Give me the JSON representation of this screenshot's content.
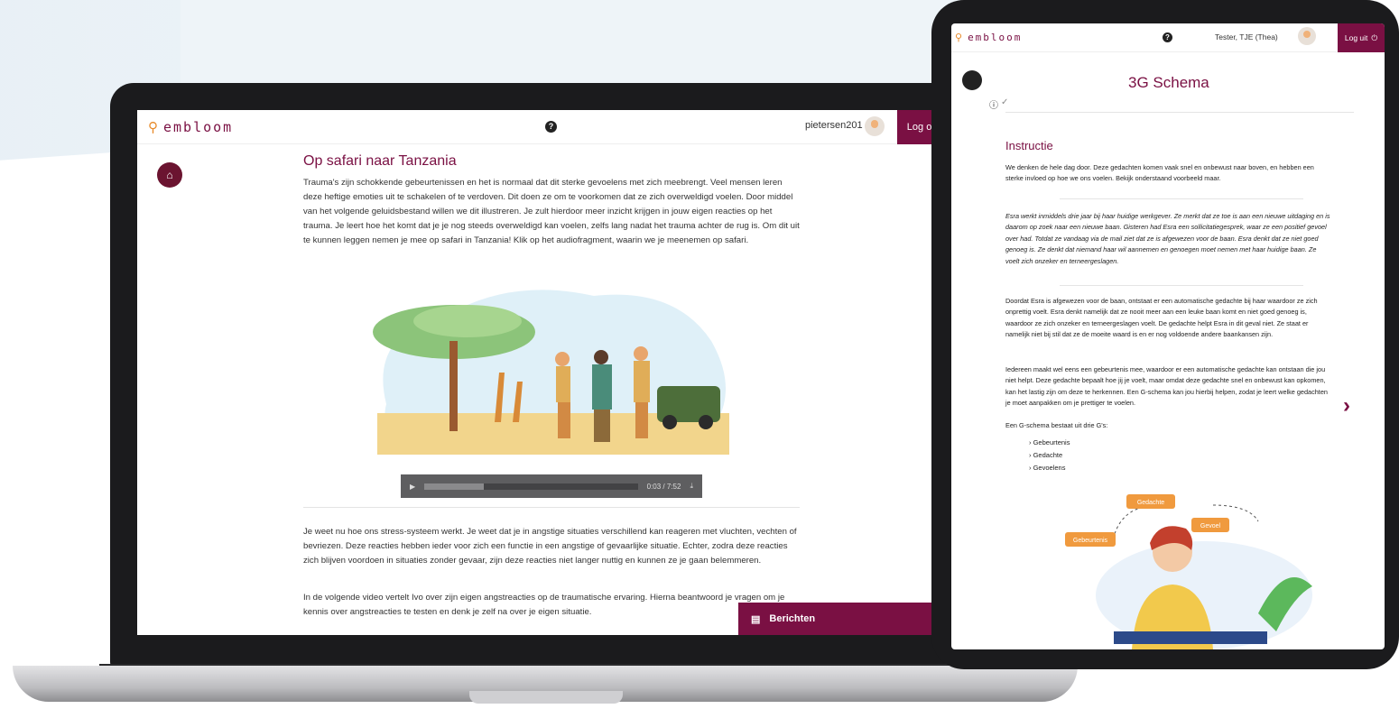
{
  "laptop": {
    "logo": "embloom",
    "username": "pietersen201",
    "logout_label": "Log out",
    "title": "Op safari naar Tanzania",
    "paragraphs": [
      "Trauma's zijn schokkende gebeurtenissen en het is normaal dat dit sterke gevoelens met zich meebrengt. Veel mensen leren deze heftige emoties uit te schakelen of te verdoven. Dit doen ze om te voorkomen dat ze zich overweldigd voelen. Door middel van het volgende geluidsbestand willen we dit illustreren. Je zult hierdoor meer inzicht krijgen in jouw eigen reacties op het trauma. Je leert hoe het komt dat je je nog steeds overweldigd kan voelen, zelfs lang nadat het trauma achter de rug is. Om dit uit te kunnen leggen nemen je mee op safari in Tanzania! Klik op het audiofragment, waarin we je meenemen op safari.",
      "Je weet nu hoe ons stress-systeem werkt. Je weet dat je in angstige situaties verschillend kan reageren met vluchten, vechten of bevriezen. Deze reacties hebben ieder voor zich een functie in een angstige of gevaarlijke situatie. Echter, zodra deze reacties zich blijven voordoen in situaties zonder gevaar, zijn deze reacties niet langer nuttig en kunnen ze je gaan belemmeren.",
      "In de volgende video vertelt Ivo over zijn eigen angstreacties op de traumatische ervaring. Hierna beantwoord je vragen om je kennis over angstreacties te testen en denk je zelf na over je eigen situatie."
    ],
    "audio": {
      "current": "0:03",
      "duration": "7:52",
      "progress": 0.28
    },
    "messages_label": "Berichten"
  },
  "tablet": {
    "logo": "embloom",
    "username": "Tester, TJE (Thea)",
    "logout_label": "Log uit",
    "title": "3G Schema",
    "section_heading": "Instructie",
    "intro": "We denken de hele dag door. Deze gedachten komen vaak snel en onbewust naar boven, en hebben een sterke invloed op hoe we ons voelen. Bekijk onderstaand voorbeeld maar.",
    "example": "Esra werkt inmiddels drie jaar bij haar huidige werkgever. Ze merkt dat ze toe is aan een nieuwe uitdaging en is daarom op zoek naar een nieuwe baan. Gisteren had Esra een sollicitatiegesprek, waar ze een positief gevoel over had. Totdat ze vandaag via de mail ziet dat ze is afgewezen voor de baan. Esra denkt dat ze niet goed genoeg is. Ze denkt dat niemand haar wil aannemen en genoegen moet nemen met haar huidige baan. Ze voelt zich onzeker en terneergeslagen.",
    "para1": "Doordat Esra is afgewezen voor de baan, ontstaat er een automatische gedachte bij haar waardoor ze zich onprettig voelt. Esra denkt namelijk dat ze nooit meer aan een leuke baan komt en niet goed genoeg is, waardoor ze zich onzeker en terneergeslagen voelt. De gedachte helpt Esra in dit geval niet. Ze staat er namelijk niet bij stil dat ze de moeite waard is en er nog voldoende andere baankansen zijn.",
    "para2": "Iedereen maakt wel eens een gebeurtenis mee, waardoor er een automatische gedachte kan ontstaan die jou niet helpt. Deze gedachte bepaalt hoe jij je voelt, maar omdat deze gedachte snel en onbewust kan opkomen, kan het lastig zijn om deze te herkennen. Een G-schema kan jou hierbij helpen, zodat je leert welke gedachten je moet aanpakken om je prettiger te voelen.",
    "list_intro": "Een G-schema bestaat uit drie G's:",
    "list": [
      "Gebeurtenis",
      "Gedachte",
      "Gevoelens"
    ],
    "diagram_labels": {
      "a": "Gebeurtenis",
      "b": "Gedachte",
      "c": "Gevoel"
    }
  },
  "colors": {
    "brand": "#7a1043",
    "accent": "#e88a2a",
    "orange_box": "#f09a3e"
  }
}
